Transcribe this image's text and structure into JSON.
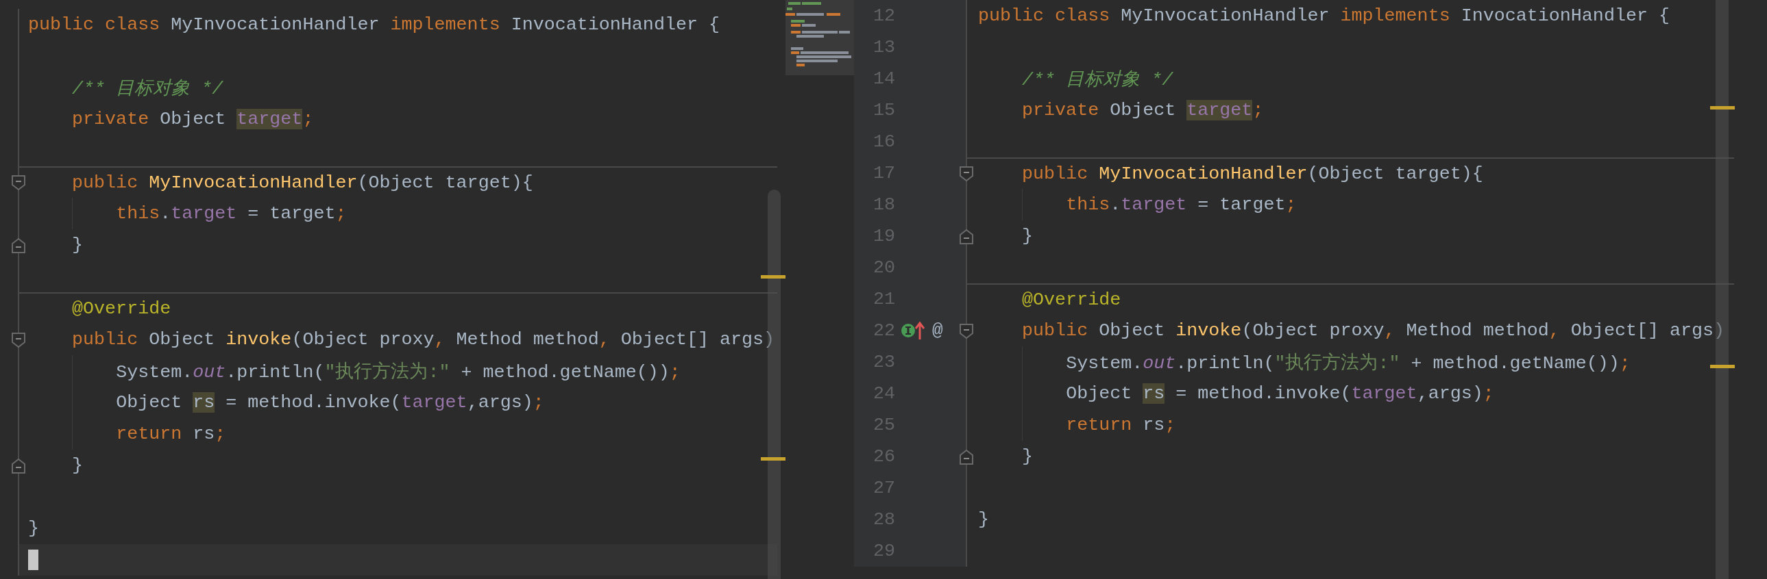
{
  "left_editor": {
    "lines": [
      {
        "code": [
          {
            "text": "public class ",
            "kind": "keyword"
          },
          {
            "text": "MyInvocationHandler ",
            "kind": "plain"
          },
          {
            "text": "implements ",
            "kind": "keyword"
          },
          {
            "text": "InvocationHandler {",
            "kind": "plain"
          }
        ]
      },
      {
        "caret": false
      },
      {
        "code": [
          {
            "text": "    /** 目标对象 */",
            "kind": "comment"
          }
        ]
      },
      {
        "code": [
          {
            "text": "    private ",
            "kind": "keyword"
          },
          {
            "text": "Object ",
            "kind": "plain"
          },
          {
            "text": "target",
            "kind": "field",
            "highlighted": true
          },
          {
            "text": ";",
            "kind": "punct"
          }
        ]
      },
      {
        "caret": false
      },
      {
        "separator_above": true,
        "fold_start": true,
        "code": [
          {
            "text": "    public ",
            "kind": "keyword"
          },
          {
            "text": "MyInvocationHandler",
            "kind": "decl"
          },
          {
            "text": "(Object target){",
            "kind": "plain"
          }
        ]
      },
      {
        "indent_guide": true,
        "code": [
          {
            "text": "        this",
            "kind": "keyword"
          },
          {
            "text": ".",
            "kind": "plain"
          },
          {
            "text": "target",
            "kind": "field"
          },
          {
            "text": " = target",
            "kind": "plain"
          },
          {
            "text": ";",
            "kind": "punct"
          }
        ]
      },
      {
        "fold_end": true,
        "code": [
          {
            "text": "    }",
            "kind": "plain"
          }
        ]
      },
      {
        "caret": false
      },
      {
        "separator_above": true,
        "code": [
          {
            "text": "    @Override",
            "kind": "annotation"
          }
        ]
      },
      {
        "fold_start": true,
        "code": [
          {
            "text": "    public ",
            "kind": "keyword"
          },
          {
            "text": "Object ",
            "kind": "plain"
          },
          {
            "text": "invoke",
            "kind": "decl"
          },
          {
            "text": "(Object proxy",
            "kind": "plain"
          },
          {
            "text": ", ",
            "kind": "punct"
          },
          {
            "text": "Method method",
            "kind": "plain"
          },
          {
            "text": ", ",
            "kind": "punct"
          },
          {
            "text": "Object[] args)",
            "kind": "plain"
          }
        ]
      },
      {
        "indent_guide": true,
        "code": [
          {
            "text": "        System.",
            "kind": "plain"
          },
          {
            "text": "out",
            "kind": "static"
          },
          {
            "text": ".println(",
            "kind": "plain"
          },
          {
            "text": "\"执行方法为:\"",
            "kind": "string"
          },
          {
            "text": " + method.getName())",
            "kind": "plain"
          },
          {
            "text": ";",
            "kind": "punct"
          }
        ]
      },
      {
        "indent_guide": true,
        "code": [
          {
            "text": "        Object ",
            "kind": "plain"
          },
          {
            "text": "rs",
            "kind": "plain",
            "highlighted": true
          },
          {
            "text": " = method.invoke(",
            "kind": "plain"
          },
          {
            "text": "target",
            "kind": "field"
          },
          {
            "text": ",args)",
            "kind": "plain"
          },
          {
            "text": ";",
            "kind": "punct"
          }
        ]
      },
      {
        "indent_guide": true,
        "code": [
          {
            "text": "        return ",
            "kind": "keyword"
          },
          {
            "text": "rs",
            "kind": "plain"
          },
          {
            "text": ";",
            "kind": "punct"
          }
        ]
      },
      {
        "fold_end": true,
        "code": [
          {
            "text": "    }",
            "kind": "plain"
          }
        ]
      },
      {
        "caret": false
      },
      {
        "code": [
          {
            "text": "}",
            "kind": "plain"
          }
        ]
      },
      {
        "caret": true
      }
    ]
  },
  "right_editor": {
    "lines": [
      {
        "number": "12",
        "code": [
          {
            "text": "public class ",
            "kind": "keyword"
          },
          {
            "text": "MyInvocationHandler ",
            "kind": "plain"
          },
          {
            "text": "implements ",
            "kind": "keyword"
          },
          {
            "text": "InvocationHandler {",
            "kind": "plain"
          }
        ]
      },
      {
        "number": "13"
      },
      {
        "number": "14",
        "code": [
          {
            "text": "    /** 目标对象 */",
            "kind": "comment"
          }
        ]
      },
      {
        "number": "15",
        "code": [
          {
            "text": "    private ",
            "kind": "keyword"
          },
          {
            "text": "Object ",
            "kind": "plain"
          },
          {
            "text": "target",
            "kind": "field",
            "highlighted": true
          },
          {
            "text": ";",
            "kind": "punct"
          }
        ]
      },
      {
        "number": "16"
      },
      {
        "number": "17",
        "separator_above": true,
        "fold_start": true,
        "code": [
          {
            "text": "    public ",
            "kind": "keyword"
          },
          {
            "text": "MyInvocationHandler",
            "kind": "decl"
          },
          {
            "text": "(Object target){",
            "kind": "plain"
          }
        ]
      },
      {
        "number": "18",
        "indent_guide": true,
        "code": [
          {
            "text": "        this",
            "kind": "keyword"
          },
          {
            "text": ".",
            "kind": "plain"
          },
          {
            "text": "target",
            "kind": "field"
          },
          {
            "text": " = target",
            "kind": "plain"
          },
          {
            "text": ";",
            "kind": "punct"
          }
        ]
      },
      {
        "number": "19",
        "fold_end": true,
        "code": [
          {
            "text": "    }",
            "kind": "plain"
          }
        ]
      },
      {
        "number": "20"
      },
      {
        "number": "21",
        "separator_above": true,
        "code": [
          {
            "text": "    @Override",
            "kind": "annotation"
          }
        ]
      },
      {
        "number": "22",
        "fold_start": true,
        "gutter": [
          {
            "kind": "implements"
          },
          {
            "kind": "text",
            "text": "@"
          }
        ],
        "code": [
          {
            "text": "    public ",
            "kind": "keyword"
          },
          {
            "text": "Object ",
            "kind": "plain"
          },
          {
            "text": "invoke",
            "kind": "decl"
          },
          {
            "text": "(Object proxy",
            "kind": "plain"
          },
          {
            "text": ", ",
            "kind": "punct"
          },
          {
            "text": "Method method",
            "kind": "plain"
          },
          {
            "text": ", ",
            "kind": "punct"
          },
          {
            "text": "Object[] args)",
            "kind": "plain"
          }
        ]
      },
      {
        "number": "23",
        "indent_guide": true,
        "code": [
          {
            "text": "        System.",
            "kind": "plain"
          },
          {
            "text": "out",
            "kind": "static"
          },
          {
            "text": ".println(",
            "kind": "plain"
          },
          {
            "text": "\"执行方法为:\"",
            "kind": "string"
          },
          {
            "text": " + method.getName())",
            "kind": "plain"
          },
          {
            "text": ";",
            "kind": "punct"
          }
        ]
      },
      {
        "number": "24",
        "indent_guide": true,
        "code": [
          {
            "text": "        Object ",
            "kind": "plain"
          },
          {
            "text": "rs",
            "kind": "plain",
            "highlighted": true
          },
          {
            "text": " = method.invoke(",
            "kind": "plain"
          },
          {
            "text": "target",
            "kind": "field"
          },
          {
            "text": ",args)",
            "kind": "plain"
          },
          {
            "text": ";",
            "kind": "punct"
          }
        ]
      },
      {
        "number": "25",
        "indent_guide": true,
        "code": [
          {
            "text": "        return ",
            "kind": "keyword"
          },
          {
            "text": "rs",
            "kind": "plain"
          },
          {
            "text": ";",
            "kind": "punct"
          }
        ]
      },
      {
        "number": "26",
        "fold_end": true,
        "code": [
          {
            "text": "    }",
            "kind": "plain"
          }
        ]
      },
      {
        "number": "27"
      },
      {
        "number": "28",
        "code": [
          {
            "text": "}",
            "kind": "plain"
          }
        ]
      },
      {
        "number": "29"
      }
    ]
  }
}
